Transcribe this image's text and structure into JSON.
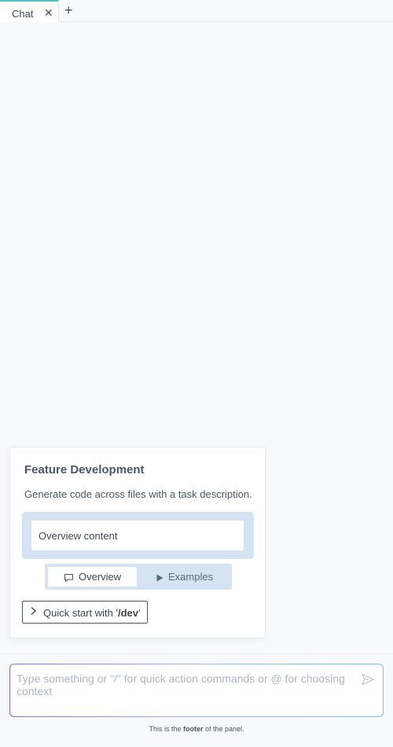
{
  "tabs": {
    "items": [
      {
        "label": "Chat",
        "close_icon": "close-icon"
      }
    ],
    "add_icon": "plus-icon"
  },
  "card": {
    "title": "Feature Development",
    "description": "Generate code across files with a task description.",
    "content_text": "Overview content",
    "toggle": {
      "selected": "Overview",
      "options": [
        {
          "label": "Overview",
          "icon": "chat-bubble-icon"
        },
        {
          "label": "Examples",
          "icon": "play-icon"
        }
      ]
    },
    "quick_start": {
      "prefix": "Quick start with '",
      "command": "/dev",
      "suffix": "'",
      "icon": "chevron-right-icon"
    }
  },
  "input": {
    "placeholder": "Type something or \"/\" for quick action commands or @ for choosing context",
    "value": "",
    "send_icon": "send-icon"
  },
  "footer": {
    "prefix": "This is the ",
    "bold": "footer",
    "suffix": " of the panel."
  },
  "colors": {
    "tab_accent": "#4fc2cc",
    "panel_background": "#f8f9fc",
    "toggle_background": "#d5e3f3"
  }
}
